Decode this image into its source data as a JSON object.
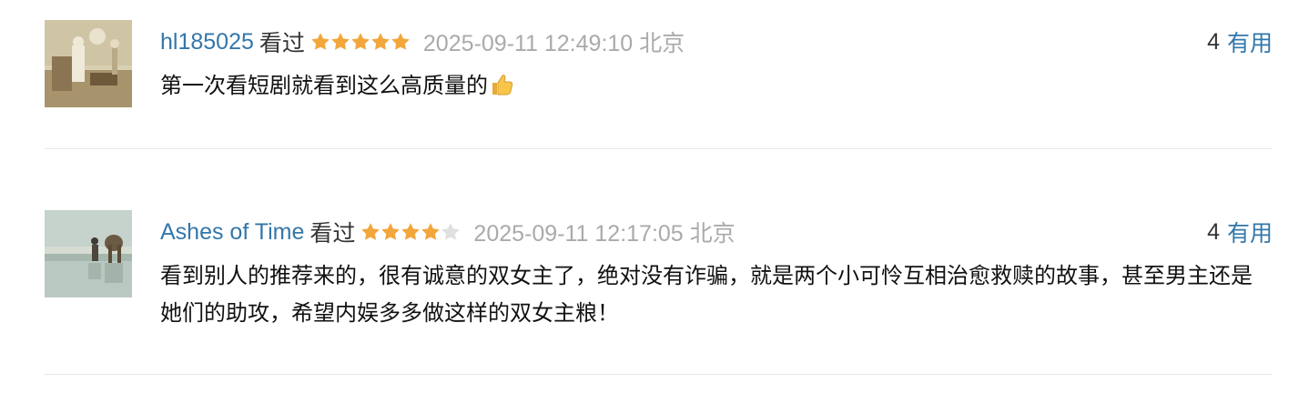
{
  "comments": [
    {
      "user": "hl185025",
      "status": "看过",
      "rating": 5,
      "time": "2025-09-11 12:49:10",
      "location": "北京",
      "text": "第一次看短剧就看到这么高质量的",
      "emoji_icon": "thumbs-up-icon",
      "votes": "4",
      "useful_label": "有用"
    },
    {
      "user": "Ashes of Time",
      "status": "看过",
      "rating": 4,
      "time": "2025-09-11 12:17:05",
      "location": "北京",
      "text": "看到别人的推荐来的，很有诚意的双女主了，绝对没有诈骗，就是两个小可怜互相治愈救赎的故事，甚至男主还是她们的助攻，希望内娱多多做这样的双女主粮！",
      "votes": "4",
      "useful_label": "有用"
    }
  ],
  "colors": {
    "link": "#3377aa",
    "meta": "#aaaaaa",
    "star_on": "#f3a63b",
    "star_off": "#e0e0e0",
    "divider": "#e8e8e8"
  }
}
